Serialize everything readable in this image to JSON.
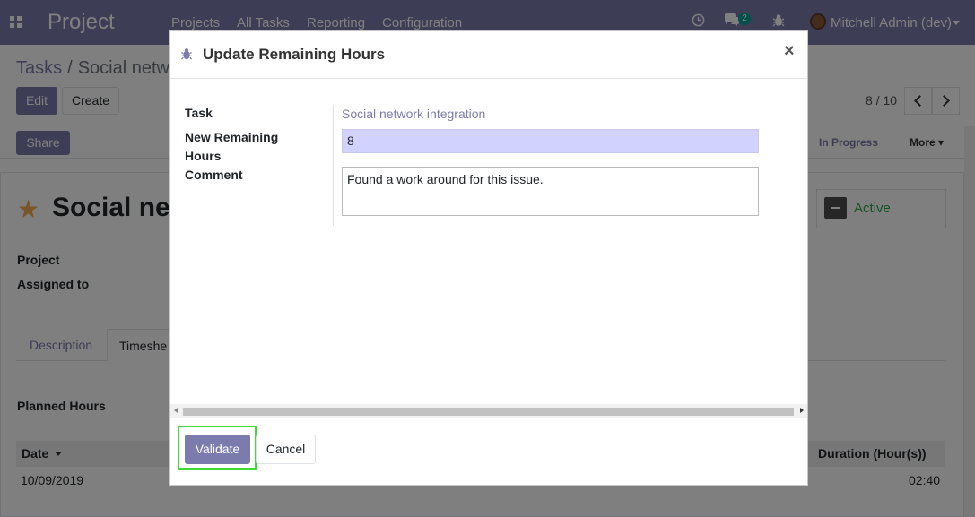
{
  "navbar": {
    "app_name": "Project",
    "menu": [
      "Projects",
      "All Tasks",
      "Reporting",
      "Configuration"
    ],
    "chat_badge": "2",
    "user_name": "Mitchell Admin (dev)"
  },
  "breadcrumb": {
    "parent": "Tasks",
    "current": "Social netw"
  },
  "controls": {
    "edit": "Edit",
    "create": "Create",
    "share": "Share",
    "pager": "8 / 10"
  },
  "stages": {
    "in_progress": "In Progress",
    "more": "More"
  },
  "record": {
    "title": "Social net",
    "active_label": "Active",
    "project_label": "Project",
    "assigned_label": "Assigned to",
    "planned_hours_label": "Planned Hours"
  },
  "tabs": {
    "description": "Description",
    "timesheets": "Timeshe"
  },
  "timesheet_table": {
    "date_header": "Date",
    "duration_header": "Duration (Hour(s))",
    "rows": [
      {
        "date": "10/09/2019",
        "duration": "02:40"
      }
    ]
  },
  "dialog": {
    "title": "Update Remaining Hours",
    "close": "×",
    "task_label": "Task",
    "task_value": "Social network integration",
    "hours_label_line1": "New Remaining",
    "hours_label_line2": "Hours",
    "hours_value": "8",
    "comment_label": "Comment",
    "comment_value": "Found a work around for this issue.",
    "validate_label": "Validate",
    "cancel_label": "Cancel"
  }
}
